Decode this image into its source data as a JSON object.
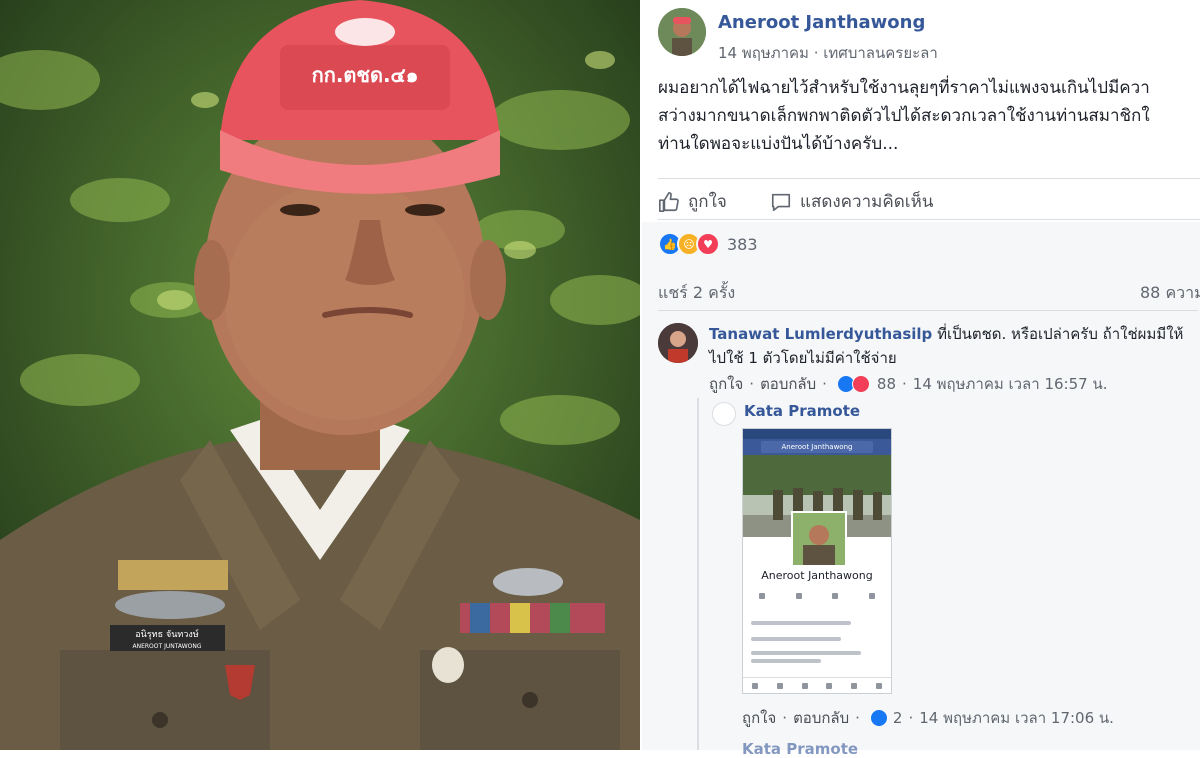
{
  "post": {
    "author": "Aneroot Janthawong",
    "date": "14 พฤษภาคม",
    "location": "เทศบาลนครยะลา",
    "text_lines": [
      "ผมอยากได้ไฟฉายไว้สำหรับใช้งานลุยๆที่ราคาไม่แพงจนเกินไปมีควา",
      "สว่างมากขนาดเล็กพกพาติดตัวไปได้สะดวกเวลาใช้งานท่านสมาชิกใ",
      "ท่านใดพอจะแบ่งปันได้บ้างครับ..."
    ],
    "like_label": "ถูกใจ",
    "comment_label": "แสดงความคิดเห็น",
    "reaction_count": "383",
    "shares": "แชร์ 2 ครั้ง",
    "comments_count": "88 ความ"
  },
  "comment1": {
    "name": "Tanawat Lumlerdyuthasilp",
    "text_line1": " ที่เป็นตชด. หรือเปล่าครับ ถ้าใช่ผมมีให้",
    "text_line2": "ไปใช้ 1 ตัวโดยไม่มีค่าใช้จ่าย",
    "like": "ถูกใจ",
    "reply": "ตอบกลับ",
    "reactions": "88",
    "time": "14 พฤษภาคม เวลา 16:57 น."
  },
  "comment2": {
    "name": "Kata Pramote",
    "like": "ถูกใจ",
    "reply": "ตอบกลับ",
    "reactions": "2",
    "time": "14 พฤษภาคม เวลา 17:06 น.",
    "screenshot": {
      "search": "Aneroot Janthawong",
      "name": "Aneroot Janthawong"
    }
  },
  "photo": {
    "cap_text": "กก.ตชด.๔๑",
    "name_tag": "อนิรุทธ จันทวงษ์",
    "name_tag_en": "ANEROOT JUNTAWONG"
  },
  "sep": "·",
  "next_comment_name": "Kata Pramote",
  "colors": {
    "fb_blue": "#365899",
    "cap_red": "#e8545e",
    "uniform": "#6b5d45"
  }
}
